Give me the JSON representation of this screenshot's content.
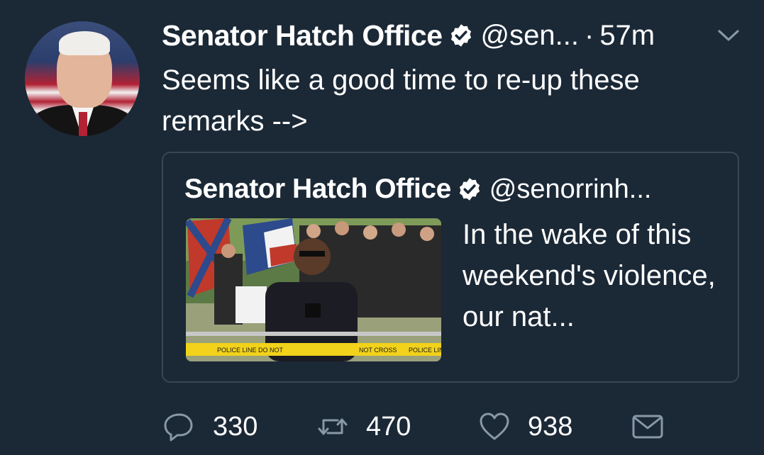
{
  "tweet": {
    "author_name": "Senator Hatch Office",
    "handle": "@sen...",
    "separator": "·",
    "time": "57m",
    "text": "Seems like a good time to re-up these remarks -->"
  },
  "quoted_tweet": {
    "author_name": "Senator Hatch Office",
    "handle": "@senorrinh...",
    "text": "In the wake of this weekend's violence, our nat...",
    "image_signs": {
      "left": "POLICE LINE DO NOT",
      "middle": "NOT CROSS",
      "right": "POLICE LINE"
    }
  },
  "actions": {
    "reply_count": "330",
    "retweet_count": "470",
    "like_count": "938"
  },
  "icons": {
    "verified": "verified-badge-icon",
    "menu": "chevron-down-icon",
    "reply": "reply-icon",
    "retweet": "retweet-icon",
    "like": "heart-icon",
    "dm": "envelope-icon"
  },
  "colors": {
    "background": "#1b2836",
    "text": "#ffffff",
    "icon": "#8899a6",
    "border": "#3a4654"
  }
}
